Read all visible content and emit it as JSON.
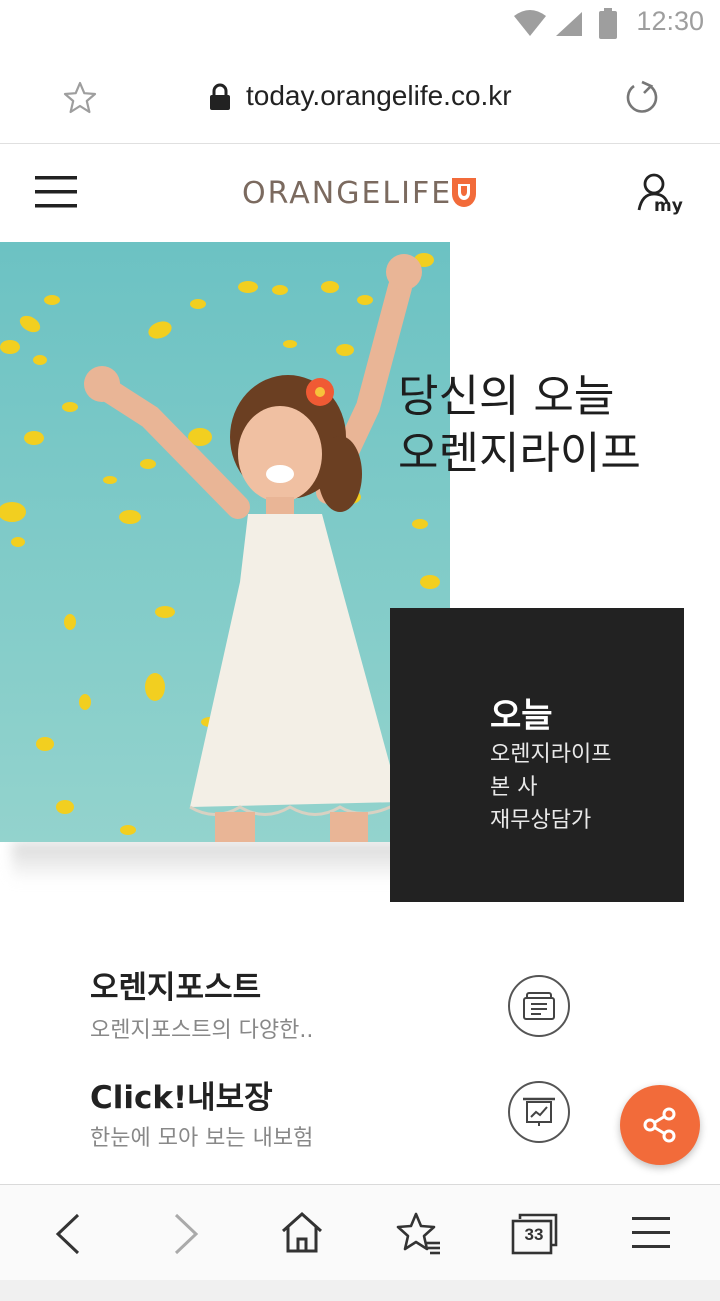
{
  "status_bar": {
    "time": "12:30",
    "icons": [
      "wifi-icon",
      "signal-icon",
      "battery-icon"
    ]
  },
  "browser": {
    "url": "today.orangelife.co.kr",
    "icons": [
      "star-icon",
      "lock-icon",
      "reload-icon"
    ]
  },
  "site": {
    "logo_text": "ORANGELIFE",
    "header_icons": [
      "menu-icon",
      "shield-logo-icon",
      "my-account-icon"
    ],
    "my_label": "my"
  },
  "hero": {
    "headline_line1": "당신의 오늘",
    "headline_line2": "오렌지라이프",
    "box_title": "오늘",
    "box_line1": "오렌지라이프",
    "box_line2": "본 사",
    "box_line3": "재무상담가"
  },
  "items": [
    {
      "title": "오렌지포스트",
      "desc": "오렌지포스트의 다양한..",
      "icon": "newspaper-icon"
    },
    {
      "title": "Click!내보장",
      "desc": "한눈에 모아 보는 내보험",
      "icon": "chart-board-icon"
    }
  ],
  "fab": {
    "icon": "share-icon",
    "color": "#f26b3a"
  },
  "bottom_nav": {
    "tab_count": "33",
    "icons": [
      "back-icon",
      "forward-icon",
      "home-icon",
      "bookmarks-icon",
      "tabs-icon",
      "menu-icon"
    ]
  },
  "colors": {
    "brand_orange": "#f26b3a",
    "logo_brown": "#7b6a5f",
    "dark_box": "#222222"
  }
}
